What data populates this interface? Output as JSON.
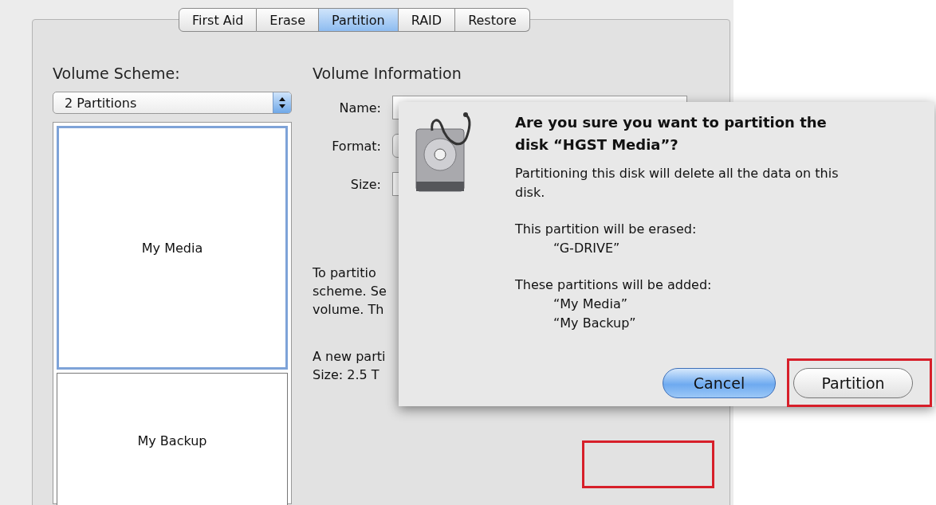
{
  "tabs": [
    {
      "label": "First Aid",
      "selected": false
    },
    {
      "label": "Erase",
      "selected": false
    },
    {
      "label": "Partition",
      "selected": true
    },
    {
      "label": "RAID",
      "selected": false
    },
    {
      "label": "Restore",
      "selected": false
    }
  ],
  "volume_scheme": {
    "label": "Volume Scheme:",
    "value": "2 Partitions",
    "partitions": [
      {
        "name": "My Media",
        "selected": true
      },
      {
        "name": "My Backup",
        "selected": false
      }
    ]
  },
  "volume_information": {
    "title": "Volume Information",
    "fields": [
      {
        "label": "Name:",
        "kind": "text"
      },
      {
        "label": "Format:",
        "kind": "popup"
      },
      {
        "label": "Size:",
        "kind": "text"
      }
    ],
    "description_lines": [
      "To partitio",
      "scheme. Se",
      "volume. Th"
    ],
    "new_partition_lines": [
      "A new parti",
      "Size: 2.5 T"
    ]
  },
  "dialog": {
    "title": "Are you sure you want to partition the disk “HGST Media”?",
    "message": "Partitioning this disk will delete all the data on this disk.",
    "erased_label": "This partition will be erased:",
    "erased": [
      "“G-DRIVE”"
    ],
    "added_label": "These partitions will be added:",
    "added": [
      "“My Media”",
      "“My Backup”"
    ],
    "buttons": [
      {
        "label": "Cancel",
        "default": true
      },
      {
        "label": "Partition",
        "default": false
      }
    ]
  }
}
